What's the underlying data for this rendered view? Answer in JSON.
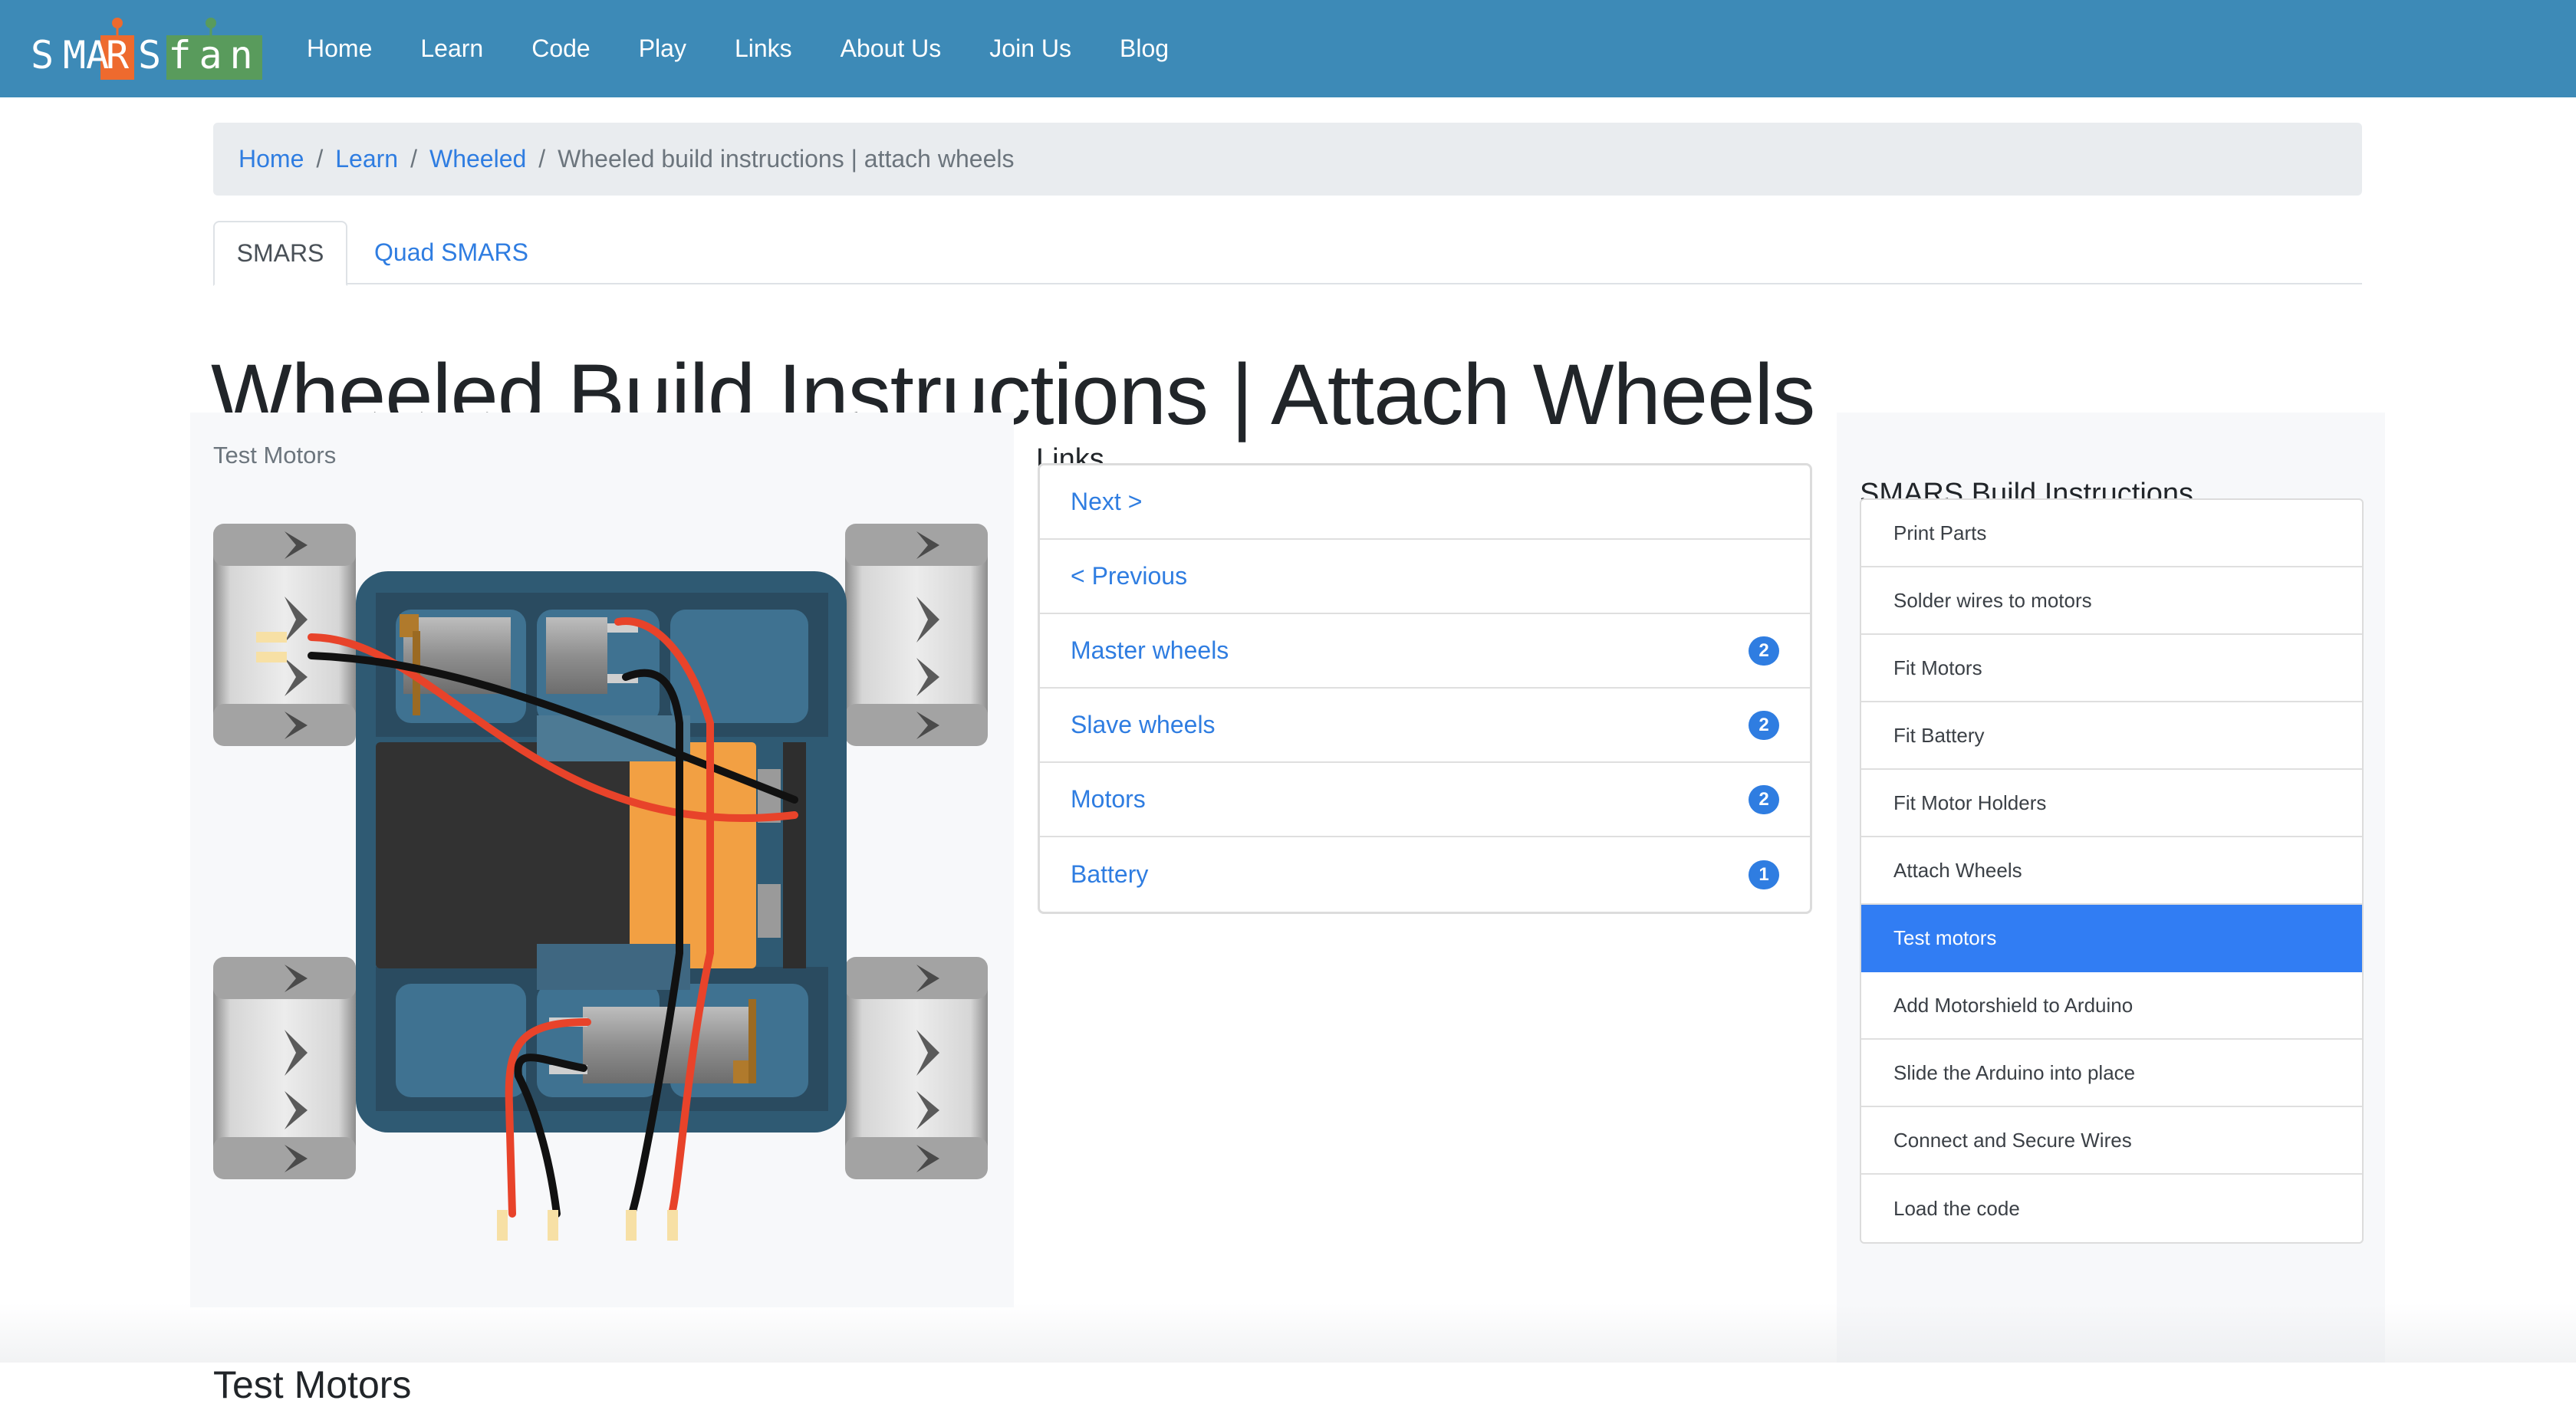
{
  "header": {
    "logo": {
      "letters": [
        "S",
        "M",
        "A",
        "R",
        "S"
      ],
      "suffix": "fan",
      "accent_r": "#ee6a2e",
      "accent_fan": "#599b5c"
    },
    "nav": [
      "Home",
      "Learn",
      "Code",
      "Play",
      "Links",
      "About Us",
      "Join Us",
      "Blog"
    ],
    "background": "#3d8ab7"
  },
  "breadcrumb": {
    "links": [
      "Home",
      "Learn",
      "Wheeled"
    ],
    "separator": "/",
    "active": "Wheeled build instructions | attach wheels"
  },
  "tabs": [
    {
      "label": "SMARS",
      "active": true
    },
    {
      "label": "Quad SMARS",
      "active": false
    }
  ],
  "page_title": "Wheeled Build Instructions | Attach Wheels",
  "left_panel": {
    "caption": "Test Motors",
    "image_alt": "SMARS robot chassis with wheels, motors, battery and wires"
  },
  "bottom_heading": "Test Motors",
  "links": {
    "heading": "Links",
    "items": [
      {
        "label": "Next >",
        "badge": null
      },
      {
        "label": "< Previous",
        "badge": null
      },
      {
        "label": "Master wheels",
        "badge": "2"
      },
      {
        "label": "Slave wheels",
        "badge": "2"
      },
      {
        "label": "Motors",
        "badge": "2"
      },
      {
        "label": "Battery",
        "badge": "1"
      }
    ]
  },
  "sidebar": {
    "heading": "SMARS Build Instructions",
    "items": [
      {
        "label": "Print Parts",
        "active": false
      },
      {
        "label": "Solder wires to motors",
        "active": false
      },
      {
        "label": "Fit Motors",
        "active": false
      },
      {
        "label": "Fit Battery",
        "active": false
      },
      {
        "label": "Fit Motor Holders",
        "active": false
      },
      {
        "label": "Attach Wheels",
        "active": false
      },
      {
        "label": "Test motors",
        "active": true
      },
      {
        "label": "Add Motorshield to Arduino",
        "active": false
      },
      {
        "label": "Slide the Arduino into place",
        "active": false
      },
      {
        "label": "Connect and Secure Wires",
        "active": false
      },
      {
        "label": "Load the code",
        "active": false
      }
    ]
  },
  "colors": {
    "link": "#2f7de1",
    "active_item": "#317df3",
    "panel_bg": "#f7f8fa",
    "breadcrumb_bg": "#e9ecef"
  }
}
